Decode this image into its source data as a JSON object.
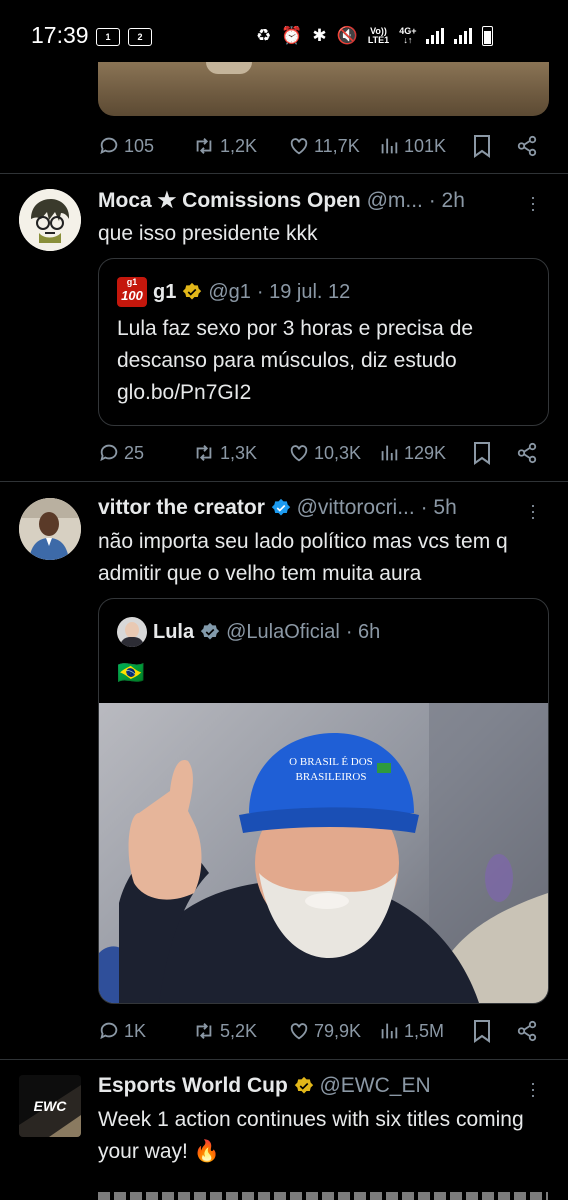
{
  "status": {
    "time": "17:39",
    "sim1": "1",
    "sim2": "2",
    "volte": "Vo))",
    "lte": "LTE1",
    "network": "4G+"
  },
  "tweets": [
    {
      "id": "t0",
      "actions": {
        "replies": "105",
        "retweets": "1,2K",
        "likes": "11,7K",
        "views": "101K"
      }
    },
    {
      "id": "t1",
      "name": "Moca ★ Comissions Open",
      "handle": "@m...",
      "time": "· 2h",
      "text": "que isso presidente kkk",
      "quote": {
        "name": "g1",
        "handle": "@g1",
        "time": "· 19 jul. 12",
        "text": "Lula faz sexo por 3 horas e precisa de descanso para músculos, diz estudo glo.bo/Pn7GI2",
        "logo_top": "g1",
        "logo_bottom": "100"
      },
      "actions": {
        "replies": "25",
        "retweets": "1,3K",
        "likes": "10,3K",
        "views": "129K"
      }
    },
    {
      "id": "t2",
      "name": "vittor the creator",
      "handle": "@vittorocri...",
      "time": "· 5h",
      "text": "não importa seu lado político mas vcs tem q admitir que o velho tem muita aura",
      "quote": {
        "name": "Lula",
        "handle": "@LulaOficial",
        "time": "· 6h",
        "flag": "🇧🇷",
        "cap_text_1": "O BRASIL É DOS",
        "cap_text_2": "BRASILEIROS"
      },
      "actions": {
        "replies": "1K",
        "retweets": "5,2K",
        "likes": "79,9K",
        "views": "1,5M"
      }
    },
    {
      "id": "t3",
      "name": "Esports World Cup",
      "handle": "@EWC_EN",
      "text": "Week 1 action continues with six titles coming your way! 🔥",
      "logo": "EWC"
    }
  ]
}
